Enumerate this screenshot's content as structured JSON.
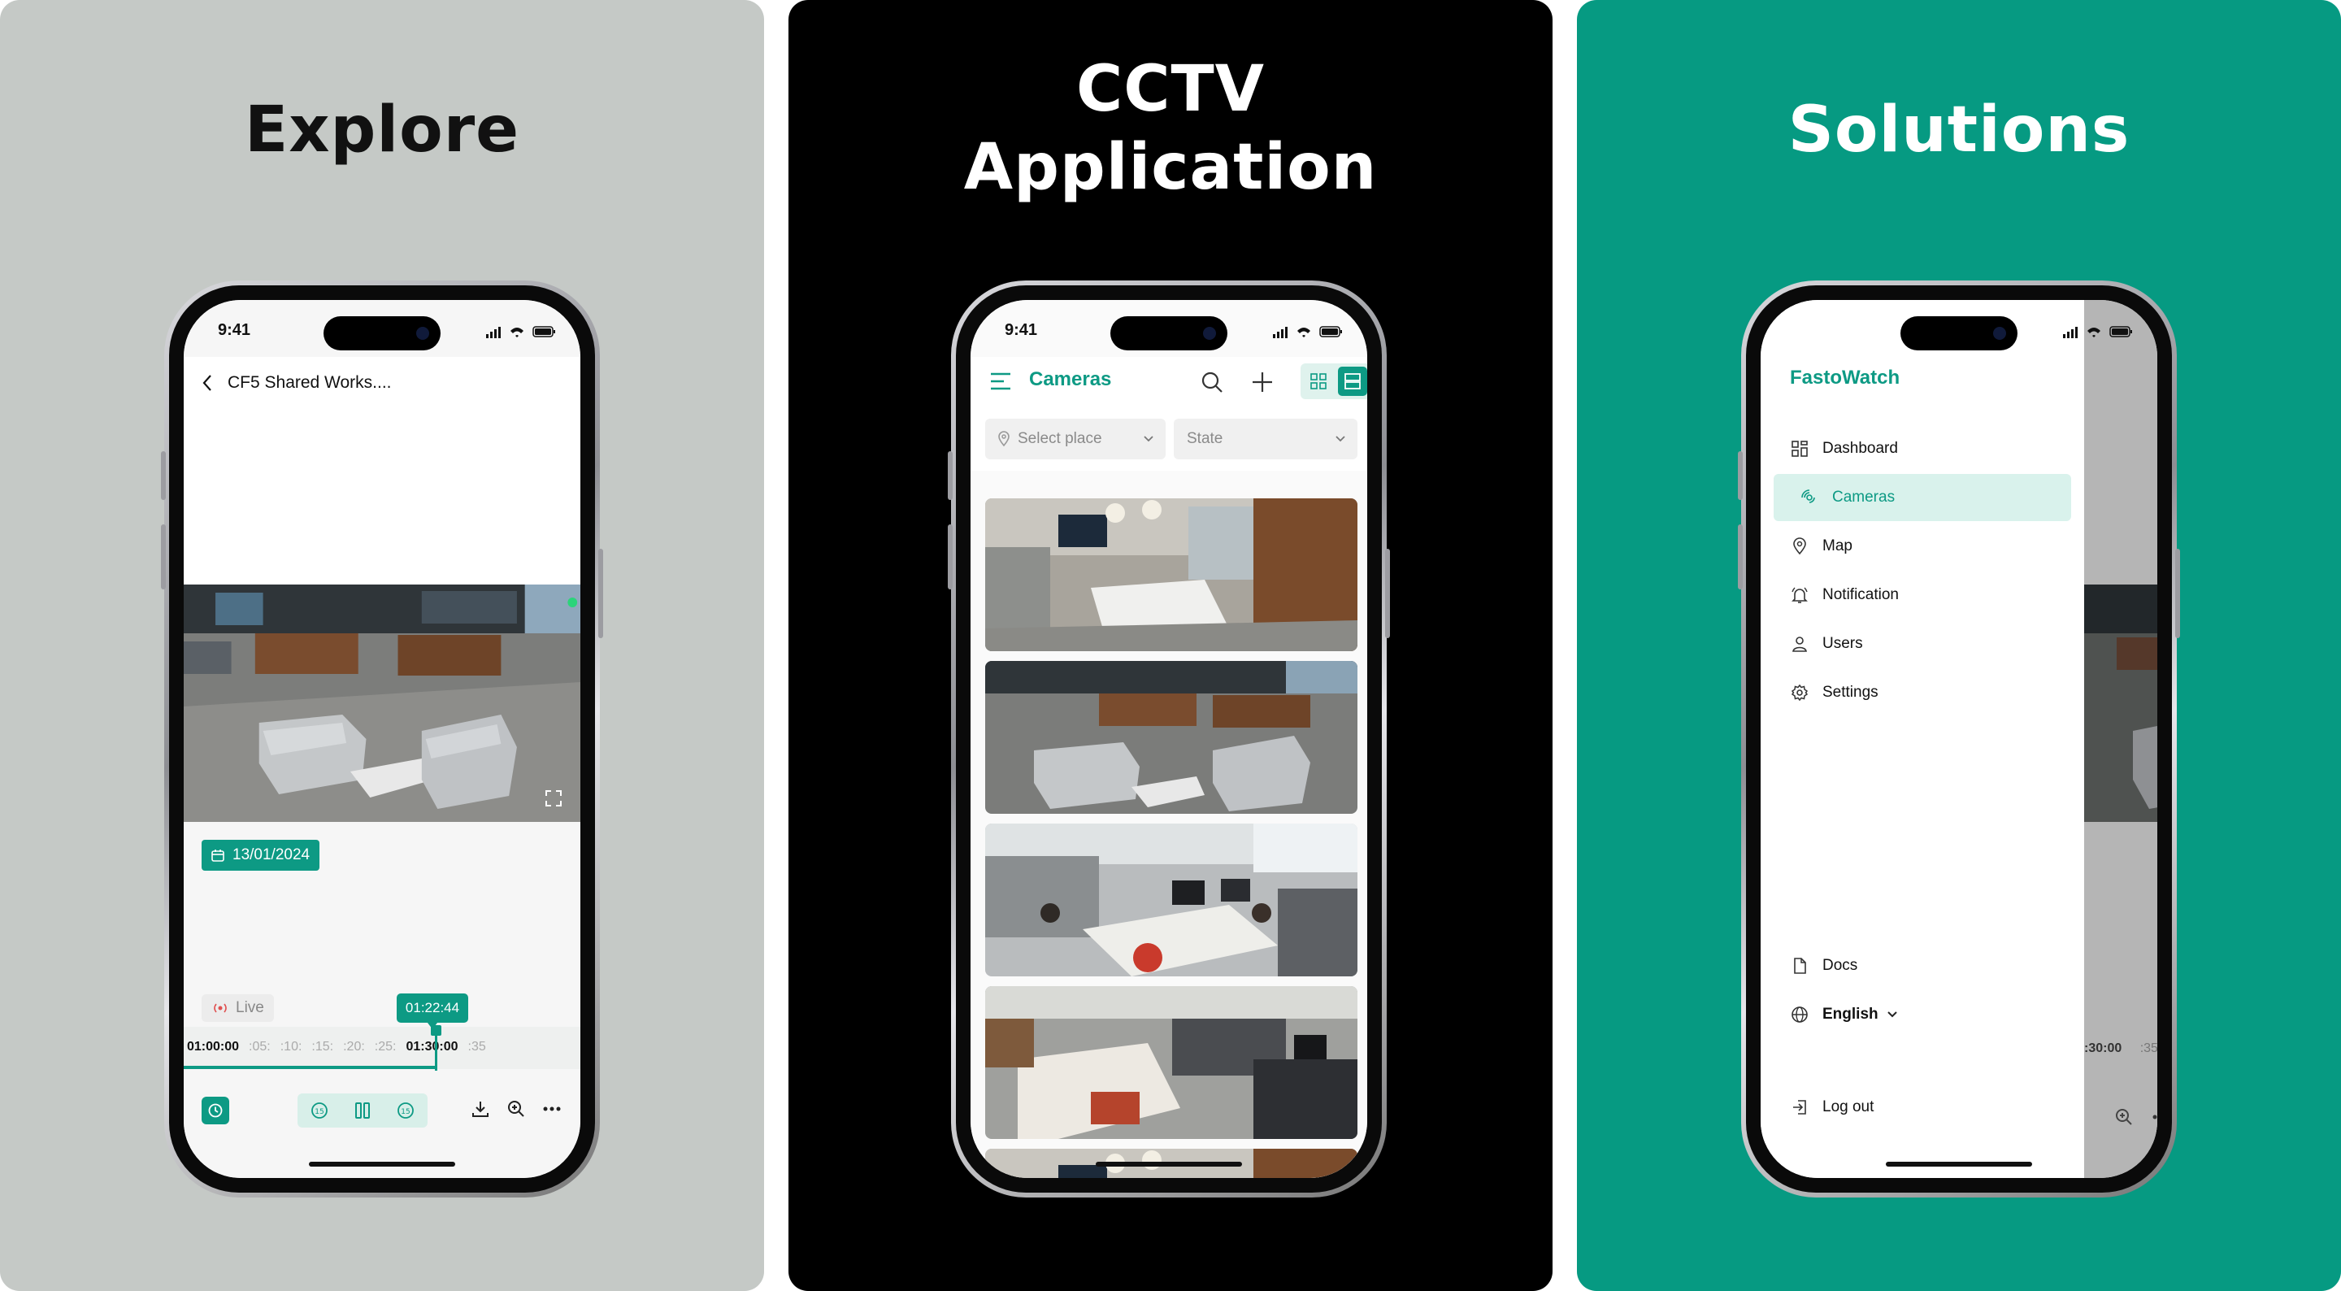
{
  "panels": [
    {
      "headline": "Explore",
      "background": "#c5c9c6"
    },
    {
      "headline_line1": "CCTV",
      "headline_line2": "Application",
      "background": "#000000"
    },
    {
      "headline": "Solutions",
      "background": "#069a82"
    }
  ],
  "status": {
    "time": "9:41"
  },
  "explore": {
    "back_title": "CF5 Shared Works....",
    "date": "13/01/2024",
    "live_label": "Live",
    "current_time": "01:22:44",
    "timeline_labels": [
      "01:00:00",
      ":05:",
      ":10:",
      ":15:",
      ":20:",
      ":25:",
      "01:30:00",
      ":35"
    ],
    "timeline_progress": 0.62,
    "controls": {
      "rewind": "rewind-15-icon",
      "pause": "pause-icon",
      "forward": "forward-15-icon",
      "download": "download-icon",
      "zoom": "zoom-in-icon",
      "more": "more-icon"
    }
  },
  "cameras": {
    "title": "Cameras",
    "filters": {
      "place_placeholder": "Select place",
      "state_placeholder": "State"
    },
    "thumbnails": [
      "conference-room",
      "lounge-area",
      "open-office",
      "office-desks",
      "conference-room-2"
    ]
  },
  "drawer": {
    "brand": "FastoWatch",
    "nav": [
      {
        "label": "Dashboard",
        "icon": "dashboard-icon"
      },
      {
        "label": "Cameras",
        "icon": "camera-icon",
        "active": true
      },
      {
        "label": "Map",
        "icon": "map-pin-icon"
      },
      {
        "label": "Notification",
        "icon": "bell-icon"
      },
      {
        "label": "Users",
        "icon": "user-icon"
      },
      {
        "label": "Settings",
        "icon": "gear-icon"
      }
    ],
    "docs": "Docs",
    "language": "English",
    "logout": "Log out",
    "bg_timeline": [
      ":30:00",
      ":35"
    ]
  },
  "accent": "#0d9a84"
}
